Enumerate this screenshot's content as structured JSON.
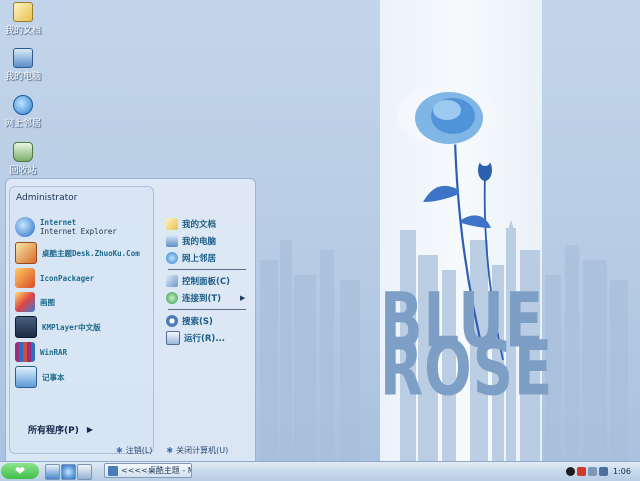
{
  "desktop_icons": [
    {
      "label": "我的文档",
      "icon": "my-documents-icon"
    },
    {
      "label": "我的电脑",
      "icon": "my-computer-icon"
    },
    {
      "label": "网上邻居",
      "icon": "network-places-icon"
    },
    {
      "label": "回收站",
      "icon": "recycle-bin-icon"
    }
  ],
  "wallpaper": {
    "line1": "BLUE",
    "line2": "ROSE"
  },
  "start_menu": {
    "user": "Administrator",
    "programs": [
      {
        "line1": "Internet",
        "line2": "Internet Explorer",
        "icon": "internet-explorer-icon"
      },
      {
        "line1": "桌酷主题Desk.ZhuoKu.Com",
        "icon": "zhuoku-theme-icon"
      },
      {
        "line1": "IconPackager",
        "icon": "iconpackager-icon"
      },
      {
        "line1": "画图",
        "icon": "paint-icon"
      },
      {
        "line1": "KMPlayer中文版",
        "icon": "kmplayer-icon"
      },
      {
        "line1": "WinRAR",
        "icon": "winrar-icon"
      },
      {
        "line1": "记事本",
        "icon": "notepad-icon"
      }
    ],
    "all_programs": "所有程序(P)",
    "places": [
      {
        "label": "我的文档",
        "icon": "my-documents-icon"
      },
      {
        "label": "我的电脑",
        "icon": "my-computer-icon"
      },
      {
        "label": "网上邻居",
        "icon": "network-places-icon"
      },
      {
        "label": "控制面板(C)",
        "icon": "control-panel-icon"
      },
      {
        "label": "连接到(T)",
        "icon": "connect-to-icon"
      },
      {
        "label": "搜索(S)",
        "icon": "search-icon"
      },
      {
        "label": "运行(R)...",
        "icon": "run-icon"
      }
    ],
    "bottom": {
      "logoff": "注销(L)",
      "shutdown": "关闭计算机(U)"
    }
  },
  "taskbar": {
    "task_label": "<<<<桌酷主题 - M...",
    "clock": "1:06",
    "colors": {
      "start": "#3fbf4c",
      "bar": "#c8d9ea"
    }
  }
}
